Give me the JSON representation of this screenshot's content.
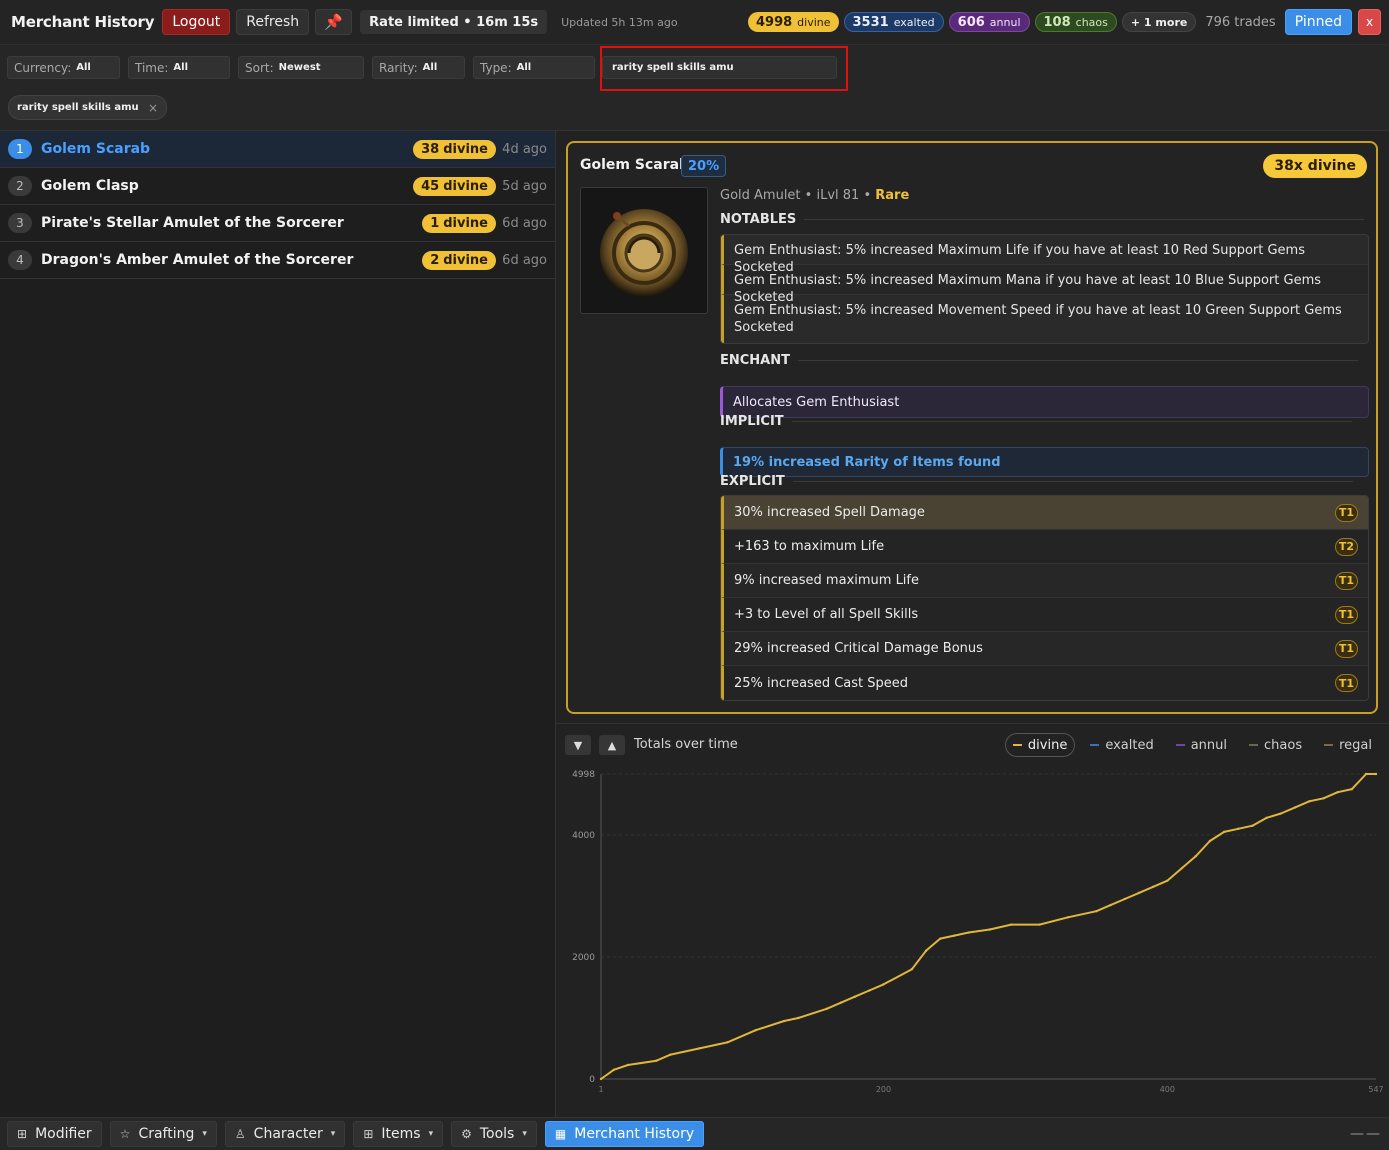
{
  "header": {
    "title": "Merchant History",
    "logout": "Logout",
    "refresh": "Refresh",
    "pin_icon": "pin-icon",
    "rate": "Rate limited • 16m 15s",
    "updated": "Updated 5h 13m ago",
    "currencies": [
      {
        "amount": "4998",
        "name": "divine"
      },
      {
        "amount": "3531",
        "name": "exalted"
      },
      {
        "amount": "606",
        "name": "annul"
      },
      {
        "amount": "108",
        "name": "chaos"
      }
    ],
    "more": "+ 1 more",
    "trades": "796 trades",
    "pinned": "Pinned",
    "close": "x"
  },
  "filters": {
    "currency": {
      "label": "Currency:",
      "value": "All"
    },
    "time": {
      "label": "Time:",
      "value": "All"
    },
    "sort": {
      "label": "Sort:",
      "value": "Newest"
    },
    "rarity": {
      "label": "Rarity:",
      "value": "All"
    },
    "type": {
      "label": "Type:",
      "value": "All"
    },
    "search": "rarity spell skills amu",
    "chip": "rarity spell skills amu",
    "chip_close": "×"
  },
  "list": [
    {
      "n": "1",
      "name": "Golem Scarab",
      "amount": "38",
      "cur": "divine",
      "ago": "4d ago"
    },
    {
      "n": "2",
      "name": "Golem Clasp",
      "amount": "45",
      "cur": "divine",
      "ago": "5d ago"
    },
    {
      "n": "3",
      "name": "Pirate's Stellar Amulet of the Sorcerer",
      "amount": "1",
      "cur": "divine",
      "ago": "6d ago"
    },
    {
      "n": "4",
      "name": "Dragon's Amber Amulet of the Sorcerer",
      "amount": "2",
      "cur": "divine",
      "ago": "6d ago"
    }
  ],
  "detail": {
    "name": "Golem Scarab",
    "pct": "20%",
    "price": "38x divine",
    "base": "Gold Amulet",
    "ilvl": "iLvl 81",
    "rarity": "Rare",
    "sec_notables": "NOTABLES",
    "notables": [
      "Gem Enthusiast: 5% increased Maximum Life if you have at least 10 Red Support Gems Socketed",
      "Gem Enthusiast: 5% increased Maximum Mana if you have at least 10 Blue Support Gems Socketed",
      "Gem Enthusiast: 5% increased Movement Speed if you have at least 10 Green Support Gems Socketed"
    ],
    "sec_enchant": "ENCHANT",
    "enchant": "Allocates Gem Enthusiast",
    "sec_implicit": "IMPLICIT",
    "implicit": "19% increased Rarity of Items found",
    "sec_explicit": "EXPLICIT",
    "explicits": [
      {
        "text": "30% increased Spell Damage",
        "tier": "T1"
      },
      {
        "text": "+163 to maximum Life",
        "tier": "T2"
      },
      {
        "text": "9% increased maximum Life",
        "tier": "T1"
      },
      {
        "text": "+3 to Level of all Spell Skills",
        "tier": "T1"
      },
      {
        "text": "29% increased Critical Damage Bonus",
        "tier": "T1"
      },
      {
        "text": "25% increased Cast Speed",
        "tier": "T1"
      }
    ]
  },
  "chart": {
    "title": "Totals over time",
    "legend": [
      {
        "name": "divine",
        "color": "#e0b73a",
        "active": true
      },
      {
        "name": "exalted",
        "color": "#3a6ec8",
        "active": false
      },
      {
        "name": "annul",
        "color": "#6a4aa8",
        "active": false
      },
      {
        "name": "chaos",
        "color": "#6a6a4a",
        "active": false
      },
      {
        "name": "regal",
        "color": "#7a6a4a",
        "active": false
      }
    ]
  },
  "chart_data": {
    "type": "line",
    "title": "Totals over time",
    "xlabel": "",
    "ylabel": "",
    "xlim": [
      1,
      547
    ],
    "ylim": [
      0,
      4998
    ],
    "x_ticks": [
      "1",
      "200",
      "400",
      "547"
    ],
    "y_ticks": [
      "0",
      "2000",
      "4000",
      "4998"
    ],
    "series": [
      {
        "name": "divine",
        "x": [
          1,
          10,
          20,
          40,
          50,
          70,
          90,
          110,
          130,
          140,
          160,
          170,
          180,
          190,
          200,
          220,
          230,
          240,
          250,
          260,
          275,
          290,
          310,
          330,
          350,
          360,
          370,
          380,
          390,
          400,
          410,
          420,
          430,
          440,
          450,
          460,
          470,
          480,
          490,
          500,
          510,
          520,
          530,
          540,
          547
        ],
        "values": [
          0,
          150,
          230,
          300,
          400,
          500,
          600,
          800,
          950,
          1000,
          1150,
          1250,
          1350,
          1450,
          1550,
          1800,
          2100,
          2300,
          2350,
          2400,
          2450,
          2530,
          2530,
          2650,
          2750,
          2850,
          2950,
          3050,
          3150,
          3250,
          3450,
          3650,
          3900,
          4050,
          4100,
          4150,
          4280,
          4350,
          4450,
          4550,
          4600,
          4700,
          4750,
          4998,
          4998
        ]
      }
    ]
  },
  "bottombar": [
    {
      "label": "Modifier",
      "icon": "grid-icon",
      "caret": ""
    },
    {
      "label": "Crafting",
      "icon": "star-icon",
      "caret": "▾"
    },
    {
      "label": "Character",
      "icon": "person-icon",
      "caret": "▾"
    },
    {
      "label": "Items",
      "icon": "grid-icon",
      "caret": "▾"
    },
    {
      "label": "Tools",
      "icon": "tools-icon",
      "caret": "▾"
    },
    {
      "label": "Merchant History",
      "icon": "table-icon",
      "caret": ""
    }
  ],
  "bottom_right": "——"
}
